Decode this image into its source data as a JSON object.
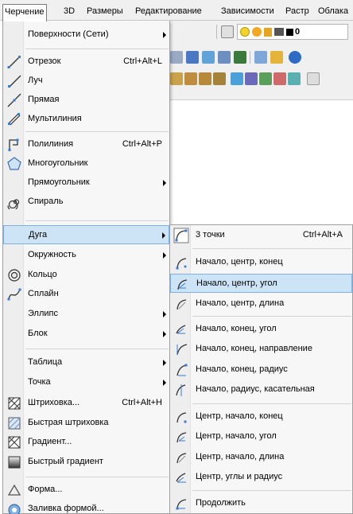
{
  "menubar": {
    "items": [
      "Черчение",
      "3D",
      "Размеры",
      "Редактирование",
      "Зависимости",
      "Растр",
      "Облака"
    ]
  },
  "toolbar": {
    "layer_value": "0"
  },
  "menu": {
    "items": [
      {
        "label": "Поверхности (Сети)",
        "shortcut": "",
        "submenu": true,
        "icon": "none"
      },
      {
        "label": "Отрезок",
        "shortcut": "Ctrl+Alt+L",
        "submenu": false,
        "icon": "line-icon"
      },
      {
        "label": "Луч",
        "shortcut": "",
        "submenu": false,
        "icon": "ray-icon"
      },
      {
        "label": "Прямая",
        "shortcut": "",
        "submenu": false,
        "icon": "xline-icon"
      },
      {
        "label": "Мультилиния",
        "shortcut": "",
        "submenu": false,
        "icon": "multiline-icon"
      },
      {
        "label": "Полилиния",
        "shortcut": "Ctrl+Alt+P",
        "submenu": false,
        "icon": "polyline-icon"
      },
      {
        "label": "Многоугольник",
        "shortcut": "",
        "submenu": false,
        "icon": "polygon-icon"
      },
      {
        "label": "Прямоугольник",
        "shortcut": "",
        "submenu": true,
        "icon": "none"
      },
      {
        "label": "Спираль",
        "shortcut": "",
        "submenu": false,
        "icon": "spiral-icon"
      },
      {
        "label": "Дуга",
        "shortcut": "",
        "submenu": true,
        "icon": "none"
      },
      {
        "label": "Окружность",
        "shortcut": "",
        "submenu": true,
        "icon": "none"
      },
      {
        "label": "Кольцо",
        "shortcut": "",
        "submenu": false,
        "icon": "donut-icon"
      },
      {
        "label": "Сплайн",
        "shortcut": "",
        "submenu": false,
        "icon": "spline-icon"
      },
      {
        "label": "Эллипс",
        "shortcut": "",
        "submenu": true,
        "icon": "none"
      },
      {
        "label": "Блок",
        "shortcut": "",
        "submenu": true,
        "icon": "none"
      },
      {
        "label": "Таблица",
        "shortcut": "",
        "submenu": true,
        "icon": "none"
      },
      {
        "label": "Точка",
        "shortcut": "",
        "submenu": true,
        "icon": "none"
      },
      {
        "label": "Штриховка...",
        "shortcut": "Ctrl+Alt+H",
        "submenu": false,
        "icon": "hatch-icon"
      },
      {
        "label": "Быстрая штриховка",
        "shortcut": "",
        "submenu": false,
        "icon": "quick-hatch-icon"
      },
      {
        "label": "Градиент...",
        "shortcut": "",
        "submenu": false,
        "icon": "gradient-icon"
      },
      {
        "label": "Быстрый градиент",
        "shortcut": "",
        "submenu": false,
        "icon": "quick-gradient-icon"
      },
      {
        "label": "Форма...",
        "shortcut": "",
        "submenu": false,
        "icon": "shape-icon"
      },
      {
        "label": "Заливка формой...",
        "shortcut": "",
        "submenu": false,
        "icon": "shape-fill-icon"
      }
    ]
  },
  "submenu": {
    "items": [
      {
        "label": "3 точки",
        "shortcut": "Ctrl+Alt+A"
      },
      {
        "label": "Начало, центр, конец",
        "shortcut": ""
      },
      {
        "label": "Начало, центр, угол",
        "shortcut": ""
      },
      {
        "label": "Начало, центр, длина",
        "shortcut": ""
      },
      {
        "label": "Начало, конец, угол",
        "shortcut": ""
      },
      {
        "label": "Начало, конец, направление",
        "shortcut": ""
      },
      {
        "label": "Начало, конец, радиус",
        "shortcut": ""
      },
      {
        "label": "Начало, радиус, касательная",
        "shortcut": ""
      },
      {
        "label": "Центр, начало, конец",
        "shortcut": ""
      },
      {
        "label": "Центр, начало, угол",
        "shortcut": ""
      },
      {
        "label": "Центр, начало, длина",
        "shortcut": ""
      },
      {
        "label": "Центр, углы и радиус",
        "shortcut": ""
      },
      {
        "label": "Продолжить",
        "shortcut": ""
      }
    ]
  }
}
